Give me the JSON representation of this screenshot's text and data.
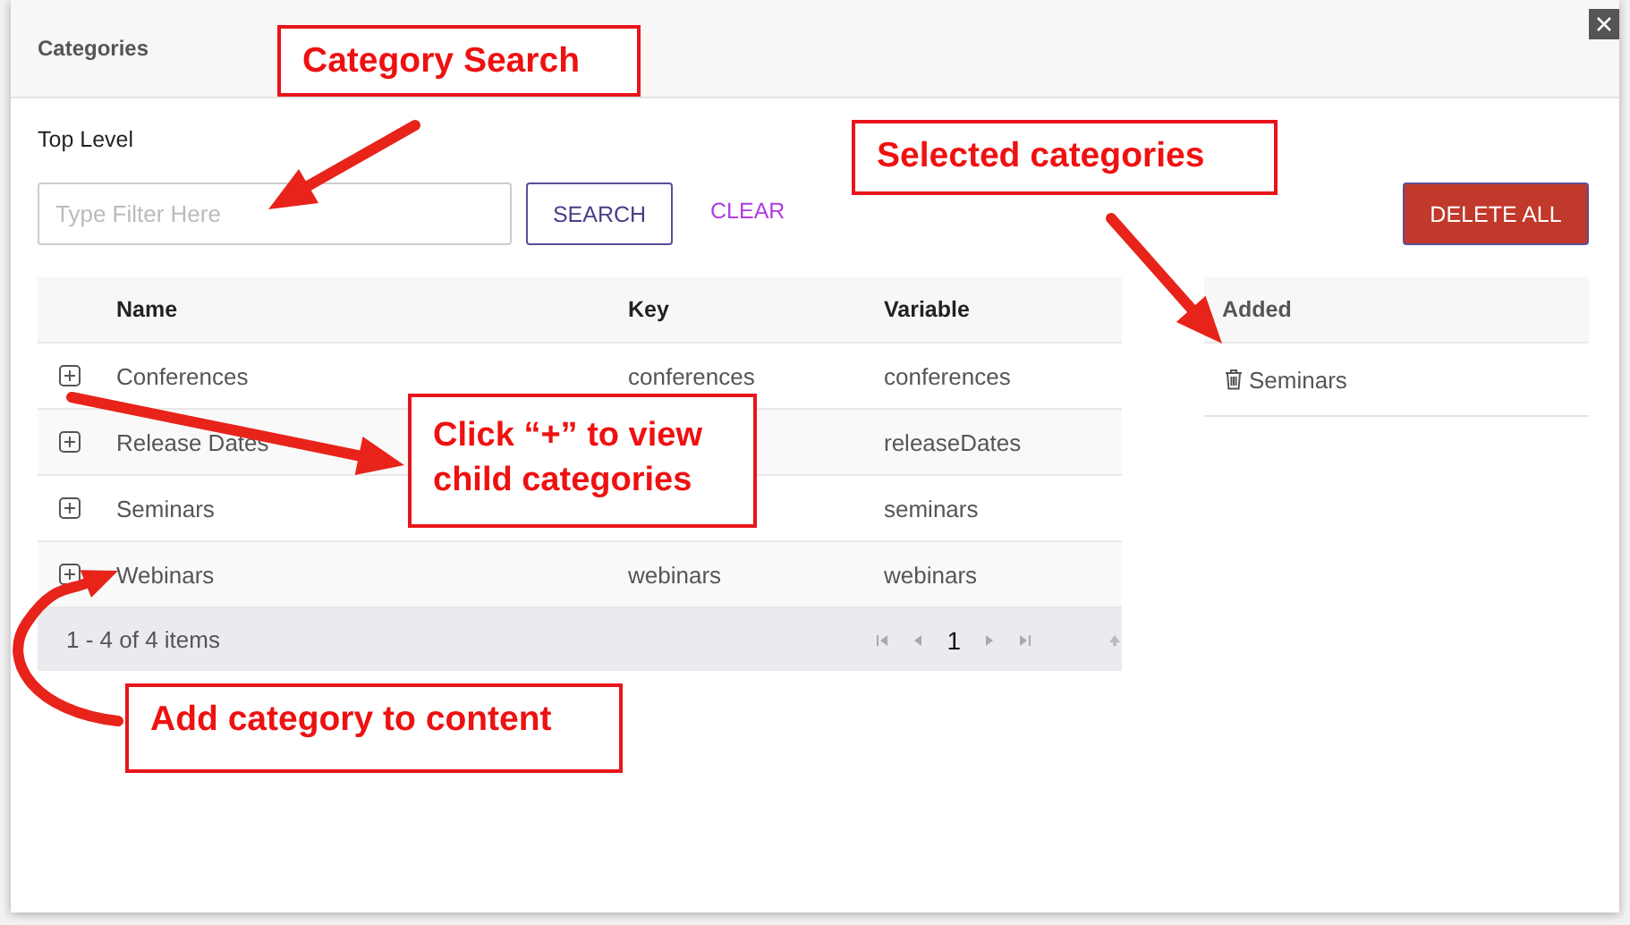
{
  "dialog": {
    "title": "Categories",
    "section_label": "Top Level"
  },
  "search": {
    "placeholder": "Type Filter Here"
  },
  "buttons": [
    {
      "kind": "search",
      "label": "SEARCH"
    },
    {
      "kind": "clear",
      "label": "CLEAR"
    },
    {
      "kind": "delete",
      "label": "DELETE ALL"
    }
  ],
  "table": {
    "columns": [
      "Name",
      "Key",
      "Variable"
    ],
    "rows": [
      {
        "name": "Conferences",
        "key": "conferences",
        "variable": "conferences"
      },
      {
        "name": "Release Dates",
        "variable": "releaseDates"
      },
      {
        "name": "Seminars",
        "variable": "seminars"
      },
      {
        "name": "Webinars",
        "key": "webinars",
        "variable": "webinars"
      }
    ]
  },
  "pager": {
    "summary": "1 - 4 of 4 items",
    "page": "1"
  },
  "added": {
    "heading": "Added",
    "items": [
      "Seminars"
    ]
  },
  "annotations": [
    {
      "text": "Category Search"
    },
    {
      "text": "Selected categories"
    },
    {
      "text": "Click “+” to view child categories"
    },
    {
      "text": "Add category to content"
    }
  ]
}
